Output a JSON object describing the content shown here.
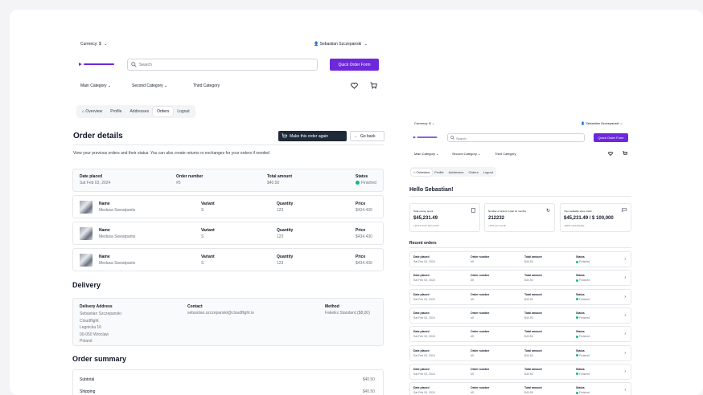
{
  "left": {
    "currency": "Currency: $",
    "user": "Sebastian Szczepanski",
    "search_placeholder": "Search",
    "quick_order": "Quick Order Form",
    "categories": [
      "Main Category",
      "Second Category",
      "Third Category"
    ],
    "tabs": [
      "Overview",
      "Profile",
      "Addresses",
      "Orders",
      "Logout"
    ],
    "title": "Order details",
    "make_again": "Make this order again",
    "go_back": "Go back",
    "description": "View your previous orders and their status. You can also create returns or exchanges for your orders if needed",
    "summary": {
      "date_label": "Date placed",
      "date": "Sat Feb 03, 2024",
      "number_label": "Order number",
      "number": "#5",
      "total_label": "Total amount",
      "total": "$40.50",
      "status_label": "Status",
      "status": "Finished"
    },
    "items": [
      {
        "name_label": "Name",
        "name": "Medusa Sweatpants",
        "variant_label": "Variant",
        "variant": "S",
        "qty_label": "Quantity",
        "qty": "123",
        "price_label": "Price",
        "price": "$434.430"
      },
      {
        "name_label": "Name",
        "name": "Medusa Sweatpants",
        "variant_label": "Variant",
        "variant": "S",
        "qty_label": "Quantity",
        "qty": "123",
        "price_label": "Price",
        "price": "$434.430"
      },
      {
        "name_label": "Name",
        "name": "Medusa Sweatpants",
        "variant_label": "Variant",
        "variant": "S",
        "qty_label": "Quantity",
        "qty": "123",
        "price_label": "Price",
        "price": "$434.430"
      }
    ],
    "delivery": {
      "heading": "Delivery",
      "address_label": "Delivery Address",
      "address_lines": [
        "Sebastian Szczepanski",
        "Cloudflight",
        "Legnicka 16",
        "00-050 Wroclaw",
        "Poland"
      ],
      "contact_label": "Contact",
      "contact": "sebastian.szczepanski@cloudflight.io",
      "method_label": "Method",
      "method": "FakeEx Standard ($8,00)"
    },
    "order_summary": {
      "heading": "Order summary",
      "subtotal_label": "Subtotal",
      "subtotal": "$40.50",
      "shipping_label": "Shipping",
      "shipping": "$40.50"
    }
  },
  "right": {
    "currency": "Currency: $",
    "user": "Sebastian Szczepanski",
    "search_placeholder": "Search",
    "quick_order": "Quick Order Form",
    "categories": [
      "Main Category",
      "Second Category",
      "Third Category"
    ],
    "tabs": [
      "Overview",
      "Profile",
      "Addresses",
      "Orders",
      "Logout"
    ],
    "greeting": "Hello Sebastian!",
    "stats": [
      {
        "label": "Total money spent",
        "value": "$45,231.49",
        "sub": "+20.1% from last month"
      },
      {
        "label": "Number of orders in last 12 months",
        "value": "212232",
        "sub": "+19% per month"
      },
      {
        "label": "Your available store credit",
        "value": "$45,231.49 / $ 100,000",
        "sub": "+$201 sold already"
      }
    ],
    "recent_heading": "Recent orders",
    "order_row": {
      "date_label": "Date placed",
      "date": "Sat Feb 03, 2024",
      "number_label": "Order number",
      "number": "#5",
      "total_label": "Total amount",
      "total": "$40.50",
      "status_label": "Status",
      "status": "Finished"
    },
    "order_count": 8
  },
  "colors": {
    "accent": "#6d28d9",
    "success": "#10b981",
    "dark_button": "#1f2937"
  }
}
